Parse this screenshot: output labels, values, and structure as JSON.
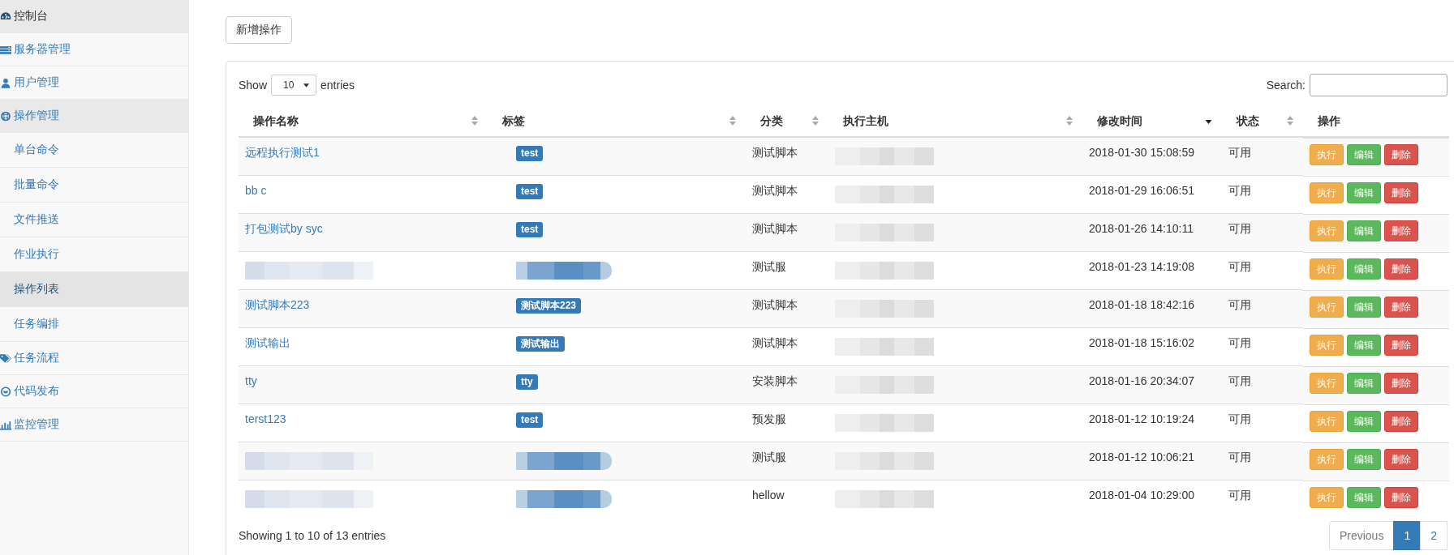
{
  "sidebar": {
    "items": [
      {
        "label": "控制台",
        "highlighted": true
      },
      {
        "label": "服务器管理",
        "highlighted": false
      },
      {
        "label": "用户管理",
        "highlighted": false
      },
      {
        "label": "操作管理",
        "highlighted": true,
        "children": [
          {
            "label": "单台命令",
            "selected": false
          },
          {
            "label": "批量命令",
            "selected": false
          },
          {
            "label": "文件推送",
            "selected": false
          },
          {
            "label": "作业执行",
            "selected": false
          },
          {
            "label": "操作列表",
            "selected": true
          },
          {
            "label": "任务编排",
            "selected": false
          }
        ]
      },
      {
        "label": "任务流程",
        "highlighted": false
      },
      {
        "label": "代码发布",
        "highlighted": false
      },
      {
        "label": "监控管理",
        "highlighted": false
      }
    ]
  },
  "add_button": "新增操作",
  "length_menu": {
    "before": "Show",
    "value": "10",
    "after": "entries"
  },
  "search": {
    "label": "Search:"
  },
  "table": {
    "columns": [
      {
        "label": "操作名称",
        "sortable": true,
        "sorted_desc": false
      },
      {
        "label": "标签",
        "sortable": true,
        "sorted_desc": false
      },
      {
        "label": "分类",
        "sortable": true,
        "sorted_desc": false
      },
      {
        "label": "执行主机",
        "sortable": true,
        "sorted_desc": false
      },
      {
        "label": "修改时间",
        "sortable": true,
        "sorted_desc": true
      },
      {
        "label": "状态",
        "sortable": true,
        "sorted_desc": false
      },
      {
        "label": "操作",
        "sortable": false,
        "sorted_desc": false
      }
    ],
    "rows": [
      {
        "name": "远程执行测试1",
        "name_blurred": false,
        "tag": "test",
        "tag_blurred": false,
        "category": "测试脚本",
        "host_blurred": true,
        "modified": "2018-01-30 15:08:59",
        "status": "可用",
        "actions": [
          {
            "label": "执行",
            "kind": "warning"
          },
          {
            "label": "编辑",
            "kind": "success"
          },
          {
            "label": "删除",
            "kind": "danger"
          }
        ]
      },
      {
        "name": "bb c",
        "name_blurred": false,
        "tag": "test",
        "tag_blurred": false,
        "category": "测试脚本",
        "host_blurred": true,
        "modified": "2018-01-29 16:06:51",
        "status": "可用",
        "actions": [
          {
            "label": "执行",
            "kind": "warning"
          },
          {
            "label": "编辑",
            "kind": "success"
          },
          {
            "label": "删除",
            "kind": "danger"
          }
        ]
      },
      {
        "name": "打包测试by syc",
        "name_blurred": false,
        "tag": "test",
        "tag_blurred": false,
        "category": "测试脚本",
        "host_blurred": true,
        "modified": "2018-01-26 14:10:11",
        "status": "可用",
        "actions": [
          {
            "label": "执行",
            "kind": "warning"
          },
          {
            "label": "编辑",
            "kind": "success"
          },
          {
            "label": "删除",
            "kind": "danger"
          }
        ]
      },
      {
        "name_blurred": true,
        "tag_blurred": true,
        "category": "测试服",
        "host_blurred": true,
        "modified": "2018-01-23 14:19:08",
        "status": "可用",
        "actions": [
          {
            "label": "执行",
            "kind": "warning"
          },
          {
            "label": "编辑",
            "kind": "success"
          },
          {
            "label": "删除",
            "kind": "danger"
          }
        ]
      },
      {
        "name": "测试脚本223",
        "name_blurred": false,
        "tag": "测试脚本223",
        "tag_blurred": false,
        "category": "测试脚本",
        "host_blurred": true,
        "modified": "2018-01-18 18:42:16",
        "status": "可用",
        "actions": [
          {
            "label": "执行",
            "kind": "warning"
          },
          {
            "label": "编辑",
            "kind": "success"
          },
          {
            "label": "删除",
            "kind": "danger"
          }
        ]
      },
      {
        "name": "测试输出",
        "name_blurred": false,
        "tag": "测试输出",
        "tag_blurred": false,
        "category": "测试脚本",
        "host_blurred": true,
        "modified": "2018-01-18 15:16:02",
        "status": "可用",
        "actions": [
          {
            "label": "执行",
            "kind": "warning"
          },
          {
            "label": "编辑",
            "kind": "success"
          },
          {
            "label": "删除",
            "kind": "danger"
          }
        ]
      },
      {
        "name": "tty",
        "name_blurred": false,
        "tag": "tty",
        "tag_blurred": false,
        "category": "安装脚本",
        "host_blurred": true,
        "modified": "2018-01-16 20:34:07",
        "status": "可用",
        "actions": [
          {
            "label": "执行",
            "kind": "warning"
          },
          {
            "label": "编辑",
            "kind": "success"
          },
          {
            "label": "删除",
            "kind": "danger"
          }
        ]
      },
      {
        "name": "terst123",
        "name_blurred": false,
        "tag": "test",
        "tag_blurred": false,
        "category": "预发服",
        "host_blurred": true,
        "modified": "2018-01-12 10:19:24",
        "status": "可用",
        "actions": [
          {
            "label": "执行",
            "kind": "warning"
          },
          {
            "label": "编辑",
            "kind": "success"
          },
          {
            "label": "删除",
            "kind": "danger"
          }
        ]
      },
      {
        "name_blurred": true,
        "tag_blurred": true,
        "category": "测试服",
        "host_blurred": true,
        "modified": "2018-01-12 10:06:21",
        "status": "可用",
        "actions": [
          {
            "label": "执行",
            "kind": "warning"
          },
          {
            "label": "编辑",
            "kind": "success"
          },
          {
            "label": "删除",
            "kind": "danger"
          }
        ]
      },
      {
        "name_blurred": true,
        "tag_blurred": true,
        "category": "hellow",
        "host_blurred": true,
        "modified": "2018-01-04 10:29:00",
        "status": "可用",
        "actions": [
          {
            "label": "执行",
            "kind": "warning"
          },
          {
            "label": "编辑",
            "kind": "success"
          },
          {
            "label": "删除",
            "kind": "danger"
          }
        ]
      }
    ]
  },
  "info": "Showing 1 to 10 of 13 entries",
  "pagination": [
    {
      "label": "Previous",
      "disabled": true,
      "selected": false
    },
    {
      "label": "1",
      "disabled": false,
      "selected": true
    },
    {
      "label": "2",
      "disabled": false,
      "selected": false
    }
  ]
}
